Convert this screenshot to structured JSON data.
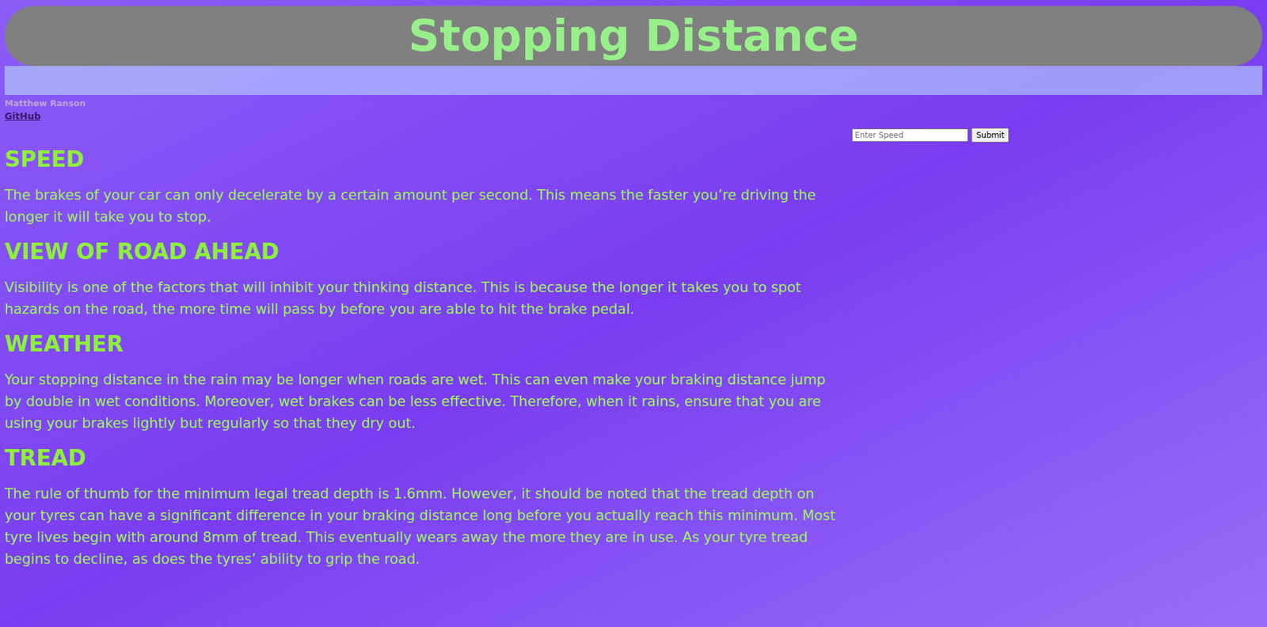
{
  "header": {
    "title": "Stopping Distance"
  },
  "author": "Matthew Ranson",
  "links": [
    {
      "label": "GitHub"
    }
  ],
  "speed_form": {
    "placeholder": "Enter Speed",
    "button": "Submit"
  },
  "sections": [
    {
      "heading": "SPEED",
      "text": "The brakes of your car can only decelerate by a certain amount per second. This means the faster you’re driving the longer it will take you to stop."
    },
    {
      "heading": "VIEW OF ROAD AHEAD",
      "text": "Visibility is one of the factors that will inhibit your thinking distance. This is because the longer it takes you to spot hazards on the road, the more time will pass by before you are able to hit the brake pedal."
    },
    {
      "heading": "WEATHER",
      "text": "Your stopping distance in the rain may be longer when roads are wet. This can even make your braking distance jump by double in wet conditions. Moreover, wet brakes can be less effective. Therefore, when it rains, ensure that you are using your brakes lightly but regularly so that they dry out."
    },
    {
      "heading": "TREAD",
      "text": "The rule of thumb for the minimum legal tread depth is 1.6mm. However, it should be noted that the tread depth on your tyres can have a significant difference in your braking distance long before you actually reach this minimum. Most tyre lives begin with around 8mm of tread. This eventually wears away the more they are in use. As your tyre tread begins to decline, as does the tyres’ ability to grip the road."
    }
  ]
}
